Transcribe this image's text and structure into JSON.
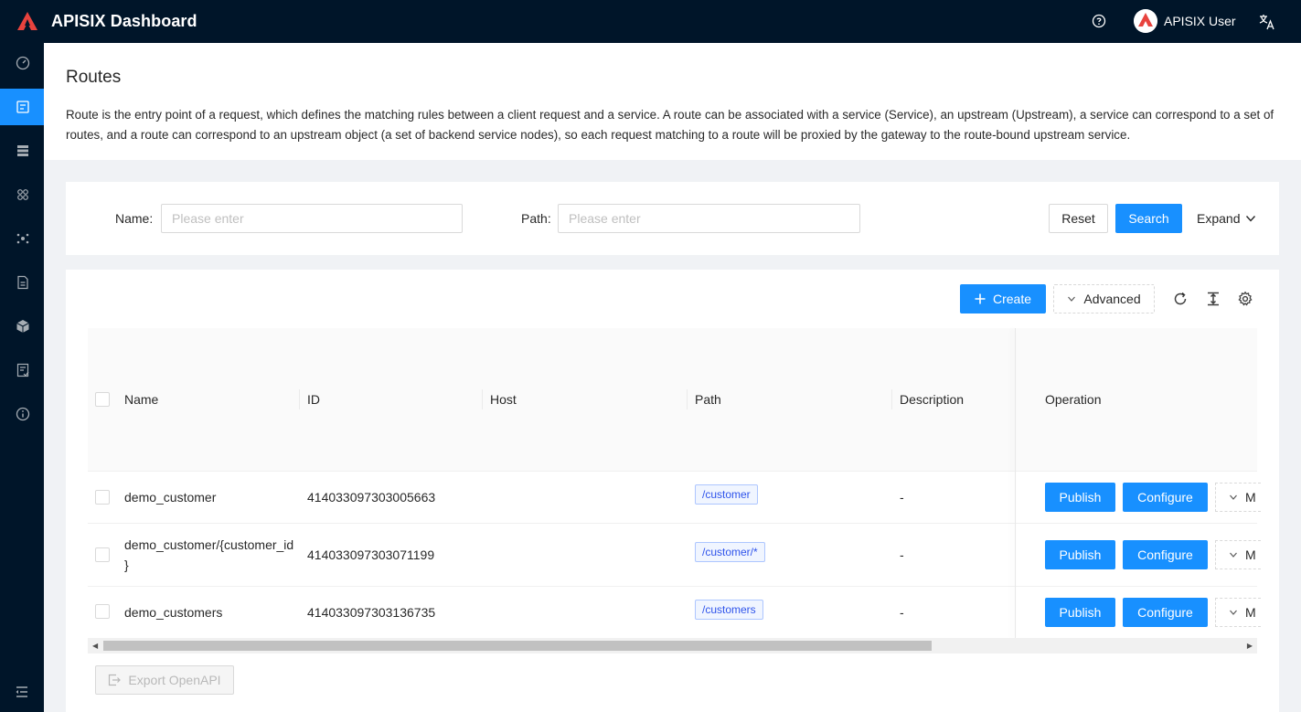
{
  "header": {
    "app_title": "APISIX Dashboard",
    "user_name": "APISIX User",
    "brand_color": "#e8433e",
    "bg_color": "#001529"
  },
  "sidebar": {
    "items": [
      {
        "icon": "dashboard-icon",
        "active": false
      },
      {
        "icon": "route-icon",
        "active": true
      },
      {
        "icon": "upstream-icon",
        "active": false
      },
      {
        "icon": "service-icon",
        "active": false
      },
      {
        "icon": "consumer-icon",
        "active": false
      },
      {
        "icon": "proto-icon",
        "active": false
      },
      {
        "icon": "plugin-icon",
        "active": false
      },
      {
        "icon": "ssl-icon",
        "active": false
      },
      {
        "icon": "info-icon",
        "active": false
      }
    ],
    "accent": "#1890ff"
  },
  "page": {
    "title": "Routes",
    "description": "Route is the entry point of a request, which defines the matching rules between a client request and a service. A route can be associated with a service (Service), an upstream (Upstream), a service can correspond to a set of routes, and a route can correspond to an upstream object (a set of backend service nodes), so each request matching to a route will be proxied by the gateway to the route-bound upstream service."
  },
  "search": {
    "name_label": "Name",
    "name_placeholder": "Please enter",
    "path_label": "Path",
    "path_placeholder": "Please enter",
    "reset_label": "Reset",
    "search_label": "Search",
    "expand_label": "Expand"
  },
  "toolbar": {
    "create_label": "Create",
    "advanced_label": "Advanced"
  },
  "table": {
    "columns": [
      "Name",
      "ID",
      "Host",
      "Path",
      "Description",
      "Operation"
    ],
    "rows": [
      {
        "name": "demo_customer",
        "id": "414033097303005663",
        "host": "",
        "path": "/customer",
        "description": "-",
        "publish": "Publish",
        "configure": "Configure",
        "more": "M"
      },
      {
        "name_line1": "demo_customer/{customer_id",
        "name_line2": "}",
        "id": "414033097303071199",
        "host": "",
        "path": "/customer/*",
        "description": "-",
        "publish": "Publish",
        "configure": "Configure",
        "more": "M"
      },
      {
        "name": "demo_customers",
        "id": "414033097303136735",
        "host": "",
        "path": "/customers",
        "description": "-",
        "publish": "Publish",
        "configure": "Configure",
        "more": "M"
      }
    ]
  },
  "footer": {
    "export_label": "Export OpenAPI"
  }
}
